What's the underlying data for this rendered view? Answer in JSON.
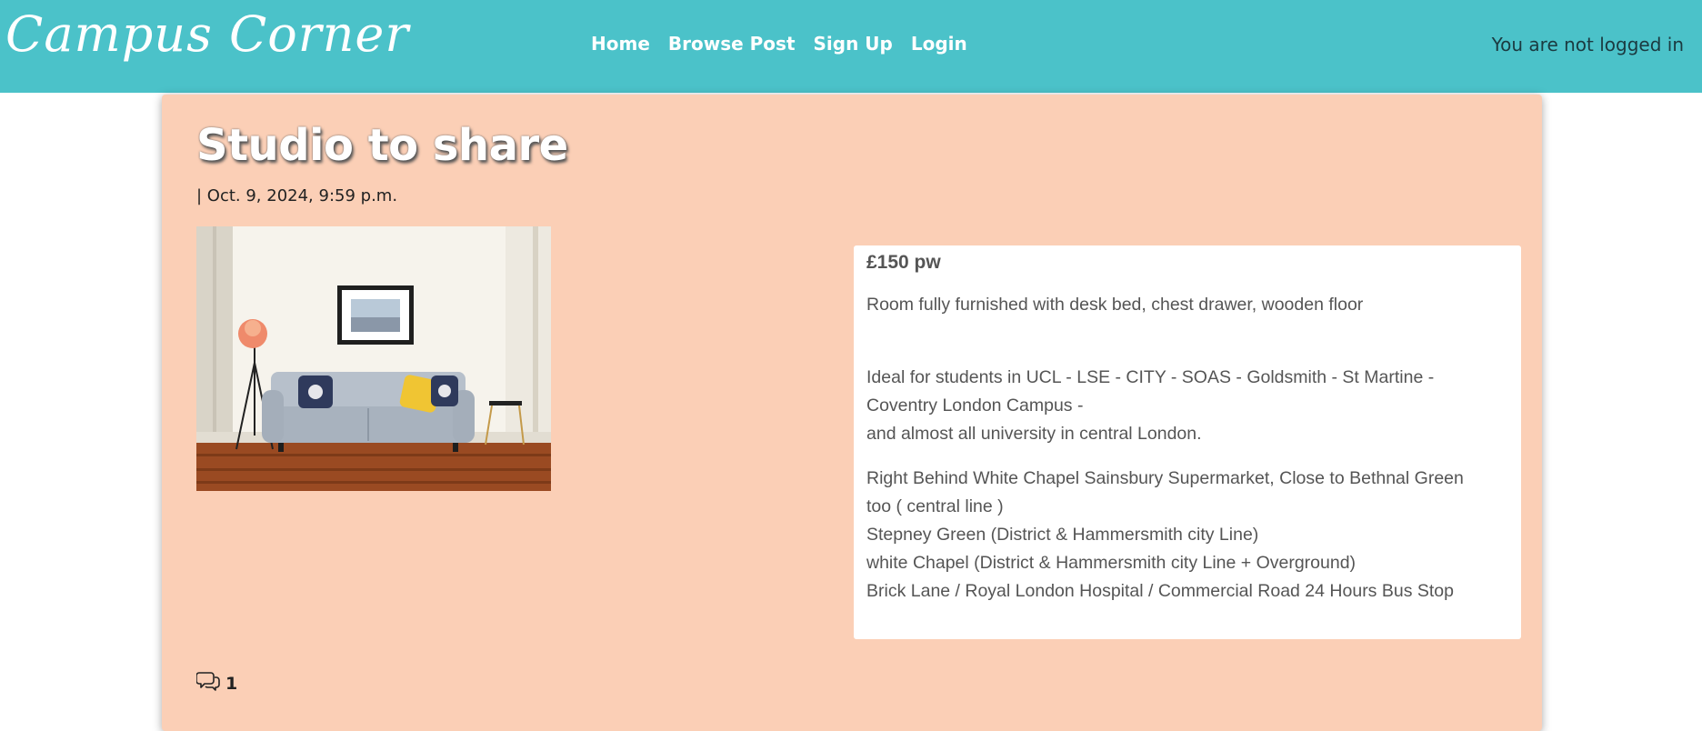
{
  "navbar": {
    "brand": "Campus Corner",
    "links": [
      "Home",
      "Browse Post",
      "Sign Up",
      "Login"
    ],
    "status": "You are not logged in"
  },
  "post": {
    "title": "Studio to share",
    "date": "| Oct. 9, 2024, 9:59 p.m.",
    "price": "£150 pw",
    "description": [
      "Room fully furnished with desk bed, chest drawer, wooden floor",
      "Ideal for students in UCL - LSE - CITY - SOAS - Goldsmith - St Martine -",
      "Coventry London Campus -",
      "and almost all university in central London.",
      "Right Behind White Chapel Sainsbury Supermarket, Close to Bethnal Green",
      "too ( central line )",
      "Stepney Green (District & Hammersmith city Line)",
      "white Chapel (District & Hammersmith city Line + Overground)",
      "Brick Lane / Royal London Hospital / Commercial Road 24 Hours Bus Stop"
    ],
    "comment_count": "1"
  },
  "colors": {
    "navbar": "#4bc2c9",
    "card": "#fbcfb6"
  }
}
